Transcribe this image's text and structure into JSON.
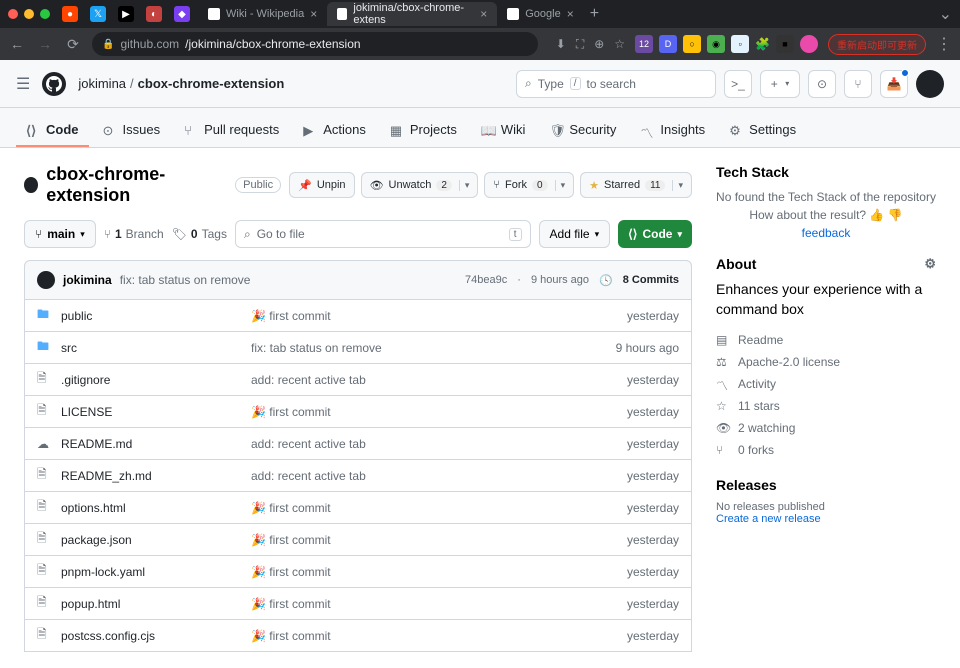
{
  "browser": {
    "tabs": [
      {
        "title": "Wiki - Wikipedia",
        "active": false
      },
      {
        "title": "jokimina/cbox-chrome-extens",
        "active": true
      },
      {
        "title": "Google",
        "active": false
      }
    ],
    "url_host": "github.com",
    "url_path": "/jokimina/cbox-chrome-extension",
    "update_label": "重新启动即可更新"
  },
  "gh": {
    "owner": "jokimina",
    "repo": "cbox-chrome-extension",
    "search_placeholder": "Type",
    "search_key": "/",
    "search_suffix": "to search"
  },
  "nav": {
    "code": "Code",
    "issues": "Issues",
    "pulls": "Pull requests",
    "actions": "Actions",
    "projects": "Projects",
    "wiki": "Wiki",
    "security": "Security",
    "insights": "Insights",
    "settings": "Settings"
  },
  "repo": {
    "name": "cbox-chrome-extension",
    "visibility": "Public",
    "unpin": "Unpin",
    "unwatch": "Unwatch",
    "watch_count": "2",
    "fork": "Fork",
    "fork_count": "0",
    "starred": "Starred",
    "star_count": "11"
  },
  "toolbar": {
    "branch": "main",
    "branch_count": "1",
    "branch_label": "Branch",
    "tag_count": "0",
    "tag_label": "Tags",
    "go_to_file": "Go to file",
    "go_key": "t",
    "add_file": "Add file",
    "code": "Code"
  },
  "commit": {
    "author": "jokimina",
    "message": "fix: tab status on remove",
    "sha": "74bea9c",
    "time": "9 hours ago",
    "count": "8 Commits"
  },
  "files": [
    {
      "type": "folder",
      "name": "public",
      "msg": "🎉 first commit",
      "date": "yesterday"
    },
    {
      "type": "folder",
      "name": "src",
      "msg": "fix: tab status on remove",
      "date": "9 hours ago"
    },
    {
      "type": "file",
      "name": ".gitignore",
      "msg": "add: recent active tab",
      "date": "yesterday"
    },
    {
      "type": "file",
      "name": "LICENSE",
      "msg": "🎉 first commit",
      "date": "yesterday"
    },
    {
      "type": "readme",
      "name": "README.md",
      "msg": "add: recent active tab",
      "date": "yesterday"
    },
    {
      "type": "file",
      "name": "README_zh.md",
      "msg": "add: recent active tab",
      "date": "yesterday"
    },
    {
      "type": "file",
      "name": "options.html",
      "msg": "🎉 first commit",
      "date": "yesterday"
    },
    {
      "type": "file",
      "name": "package.json",
      "msg": "🎉 first commit",
      "date": "yesterday"
    },
    {
      "type": "file",
      "name": "pnpm-lock.yaml",
      "msg": "🎉 first commit",
      "date": "yesterday"
    },
    {
      "type": "file",
      "name": "popup.html",
      "msg": "🎉 first commit",
      "date": "yesterday"
    },
    {
      "type": "file",
      "name": "postcss.config.cjs",
      "msg": "🎉 first commit",
      "date": "yesterday"
    }
  ],
  "sidebar": {
    "tech_title": "Tech Stack",
    "tech_msg1": "No found the Tech Stack of the repository",
    "tech_msg2": "How about the result? 👍 👎",
    "tech_feedback": "feedback",
    "about_title": "About",
    "about_desc": "Enhances your experience with a command box",
    "readme": "Readme",
    "license": "Apache-2.0 license",
    "activity": "Activity",
    "stars": "11 stars",
    "watching": "2 watching",
    "forks": "0 forks",
    "releases_title": "Releases",
    "no_releases": "No releases published",
    "create_release": "Create a new release"
  }
}
